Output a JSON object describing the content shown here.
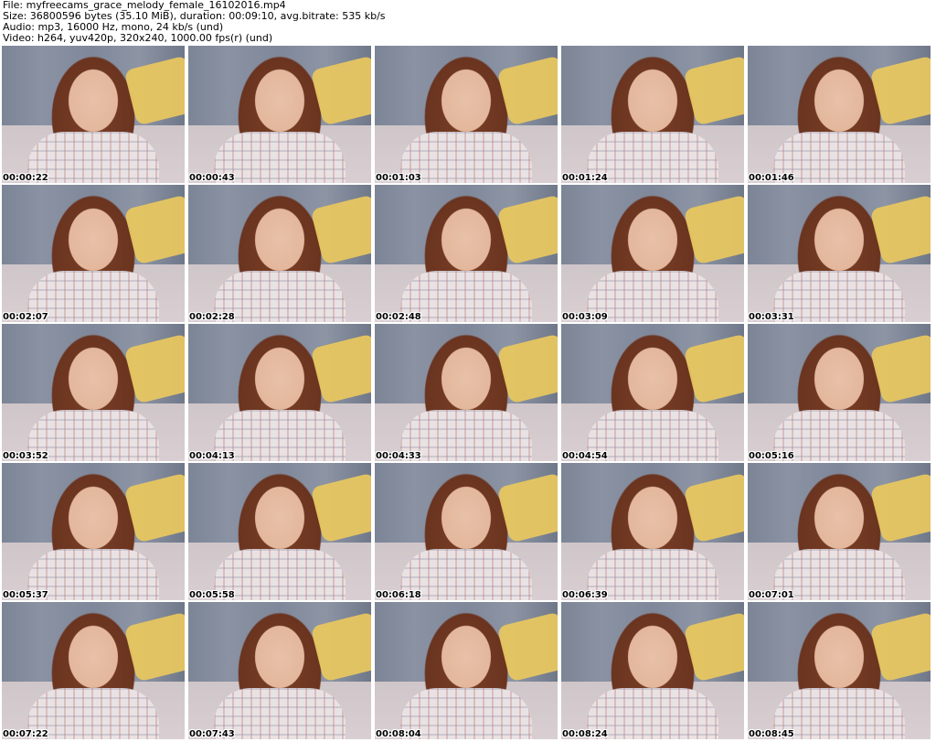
{
  "header": {
    "file_line": "File: myfreecams_grace_melody_female_16102016.mp4",
    "size_line": "Size: 36800596 bytes (35.10 MiB), duration: 00:09:10, avg.bitrate: 535 kb/s",
    "audio_line": "Audio: mp3, 16000 Hz, mono, 24 kb/s (und)",
    "video_line": "Video: h264, yuv420p, 320x240, 1000.00 fps(r) (und)"
  },
  "thumbnails": [
    {
      "timestamp": "00:00:22"
    },
    {
      "timestamp": "00:00:43"
    },
    {
      "timestamp": "00:01:03"
    },
    {
      "timestamp": "00:01:24"
    },
    {
      "timestamp": "00:01:46"
    },
    {
      "timestamp": "00:02:07"
    },
    {
      "timestamp": "00:02:28"
    },
    {
      "timestamp": "00:02:48"
    },
    {
      "timestamp": "00:03:09"
    },
    {
      "timestamp": "00:03:31"
    },
    {
      "timestamp": "00:03:52"
    },
    {
      "timestamp": "00:04:13"
    },
    {
      "timestamp": "00:04:33"
    },
    {
      "timestamp": "00:04:54"
    },
    {
      "timestamp": "00:05:16"
    },
    {
      "timestamp": "00:05:37"
    },
    {
      "timestamp": "00:05:58"
    },
    {
      "timestamp": "00:06:18"
    },
    {
      "timestamp": "00:06:39"
    },
    {
      "timestamp": "00:07:01"
    },
    {
      "timestamp": "00:07:22"
    },
    {
      "timestamp": "00:07:43"
    },
    {
      "timestamp": "00:08:04"
    },
    {
      "timestamp": "00:08:24"
    },
    {
      "timestamp": "00:08:45"
    }
  ]
}
